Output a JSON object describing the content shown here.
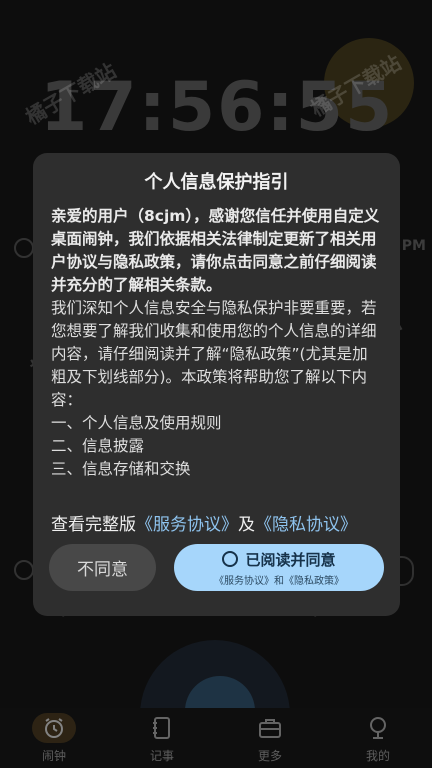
{
  "background": {
    "time": "17:56:55",
    "meridiem": "PM"
  },
  "watermark": "橘子下载站",
  "nav": {
    "items": [
      {
        "label": "闹钟",
        "icon": "alarm-clock-icon",
        "active": true
      },
      {
        "label": "记事",
        "icon": "notebook-icon",
        "active": false
      },
      {
        "label": "更多",
        "icon": "toolbox-icon",
        "active": false
      },
      {
        "label": "我的",
        "icon": "profile-icon",
        "active": false
      }
    ]
  },
  "dialog": {
    "title": "个人信息保护指引",
    "intro": "亲爱的用户（8cjm），感谢您信任并使用自定义桌面闹钟，我们依据相关法律制定更新了相关用户协议与隐私政策，请你点击同意之前仔细阅读并充分的了解相关条款。",
    "body": "我们深知个人信息安全与隐私保护非要重要，若您想要了解我们收集和使用您的个人信息的详细内容，请仔细阅读并了解“隐私政策”(尤其是加粗及下划线部分)。本政策将帮助您了解以下内容：",
    "list": [
      "一、个人信息及使用规则",
      "二、信息披露",
      "三、信息存储和交换"
    ],
    "links_prefix": "查看完整版",
    "service_link": "《服务协议》",
    "links_and": "及",
    "privacy_link": "《隐私协议》",
    "decline_label": "不同意",
    "accept_label": "已阅读并同意",
    "accept_sub": "《服务协议》和《隐私政策》"
  },
  "colors": {
    "dialog_bg": "#2e2e2e",
    "link": "#8ec3ee",
    "accept_bg": "#a6d6fb",
    "nav_active": "#45371f"
  }
}
